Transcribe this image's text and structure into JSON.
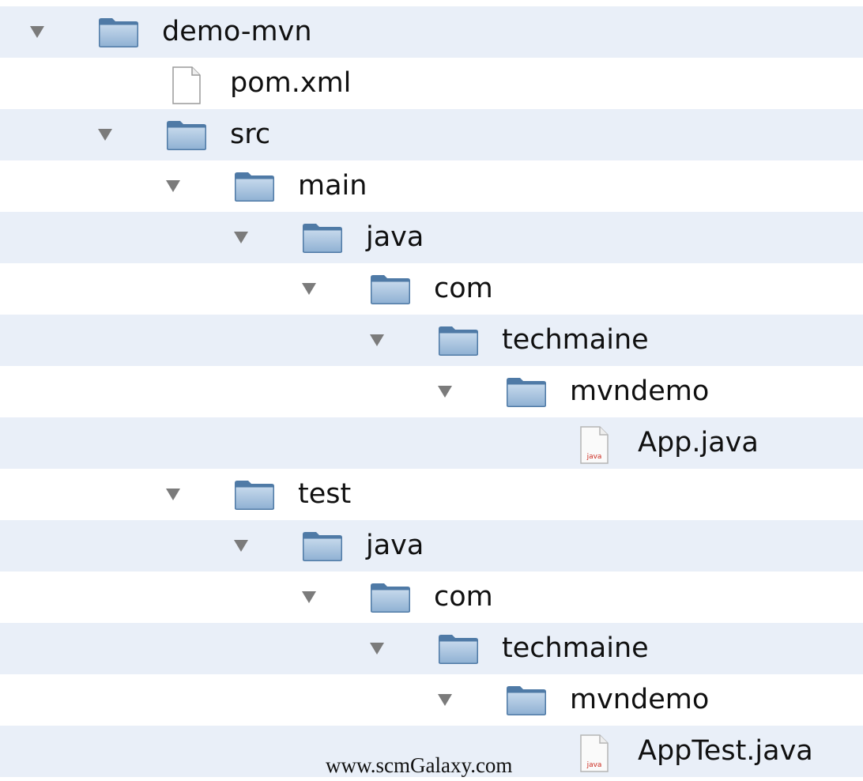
{
  "tree": [
    {
      "label": "demo-mvn",
      "type": "folder",
      "level": 0,
      "expanded": true
    },
    {
      "label": "pom.xml",
      "type": "file",
      "icon": "document-icon",
      "level": 1
    },
    {
      "label": "src",
      "type": "folder",
      "level": 1,
      "expanded": true
    },
    {
      "label": "main",
      "type": "folder",
      "level": 2,
      "expanded": true
    },
    {
      "label": "java",
      "type": "folder",
      "level": 3,
      "expanded": true
    },
    {
      "label": "com",
      "type": "folder",
      "level": 4,
      "expanded": true
    },
    {
      "label": "techmaine",
      "type": "folder",
      "level": 5,
      "expanded": true
    },
    {
      "label": "mvndemo",
      "type": "folder",
      "level": 6,
      "expanded": true
    },
    {
      "label": "App.java",
      "type": "file",
      "icon": "java-file-icon",
      "icon_text": "java",
      "level": 7
    },
    {
      "label": "test",
      "type": "folder",
      "level": 2,
      "expanded": true
    },
    {
      "label": "java",
      "type": "folder",
      "level": 3,
      "expanded": true
    },
    {
      "label": "com",
      "type": "folder",
      "level": 4,
      "expanded": true
    },
    {
      "label": "techmaine",
      "type": "folder",
      "level": 5,
      "expanded": true
    },
    {
      "label": "mvndemo",
      "type": "folder",
      "level": 6,
      "expanded": true
    },
    {
      "label": "AppTest.java",
      "type": "file",
      "icon": "java-file-icon",
      "icon_text": "java",
      "level": 7
    }
  ],
  "watermark": "www.scmGalaxy.com",
  "colors": {
    "stripe": "#e9eff8",
    "background": "#ffffff",
    "folder_fill": "#8fb1d3",
    "folder_dark": "#4f7aa6",
    "disclosure_triangle": "#7b7b7b",
    "java_text": "#cc2a1f"
  }
}
